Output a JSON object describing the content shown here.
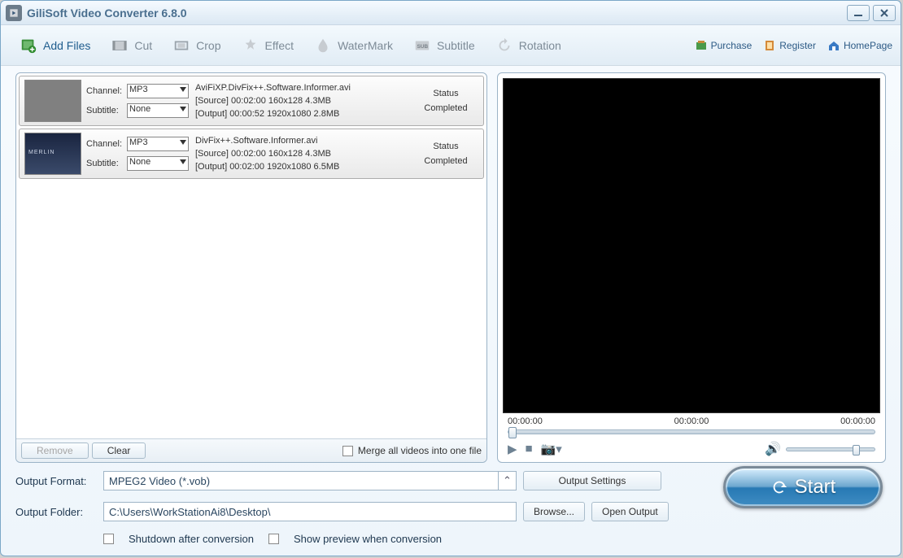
{
  "title": "GiliSoft Video Converter 6.8.0",
  "toolbar": {
    "add_files": "Add Files",
    "cut": "Cut",
    "crop": "Crop",
    "effect": "Effect",
    "watermark": "WaterMark",
    "subtitle": "Subtitle",
    "rotation": "Rotation"
  },
  "right_menu": {
    "purchase": "Purchase",
    "register": "Register",
    "homepage": "HomePage"
  },
  "files": [
    {
      "channel_label": "Channel:",
      "channel_value": "MP3",
      "subtitle_label": "Subtitle:",
      "subtitle_value": "None",
      "name": "AviFiXP.DivFix++.Software.Informer.avi",
      "source": "[Source]  00:02:00  160x128  4.3MB",
      "output": "[Output]  00:00:52  1920x1080  2.8MB",
      "status_label": "Status",
      "status_value": "Completed"
    },
    {
      "channel_label": "Channel:",
      "channel_value": "MP3",
      "subtitle_label": "Subtitle:",
      "subtitle_value": "None",
      "name": "DivFix++.Software.Informer.avi",
      "source": "[Source]  00:02:00  160x128  4.3MB",
      "output": "[Output]  00:02:00  1920x1080  6.5MB",
      "status_label": "Status",
      "status_value": "Completed"
    }
  ],
  "file_footer": {
    "remove": "Remove",
    "clear": "Clear",
    "merge": "Merge all videos into one file"
  },
  "preview": {
    "t1": "00:00:00",
    "t2": "00:00:00",
    "t3": "00:00:00"
  },
  "output": {
    "format_label": "Output Format:",
    "format_value": "MPEG2 Video (*.vob)",
    "folder_label": "Output Folder:",
    "folder_value": "C:\\Users\\WorkStationAi8\\Desktop\\",
    "settings": "Output Settings",
    "browse": "Browse...",
    "open": "Open Output"
  },
  "checks": {
    "shutdown": "Shutdown after conversion",
    "preview": "Show preview when conversion"
  },
  "start": "Start"
}
